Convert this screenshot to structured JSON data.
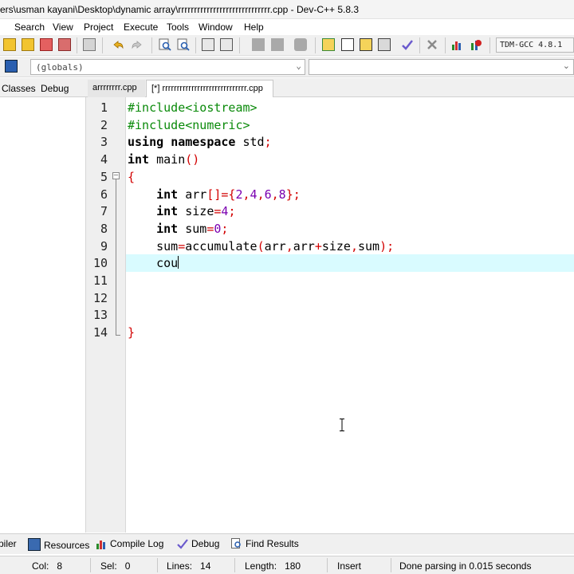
{
  "window": {
    "title": "ers\\usman kayani\\Desktop\\dynamic array\\rrrrrrrrrrrrrrrrrrrrrrrrrrrrr.cpp - Dev-C++ 5.8.3"
  },
  "menu": {
    "items": [
      "Search",
      "View",
      "Project",
      "Execute",
      "Tools",
      "Window",
      "Help"
    ]
  },
  "toolbar": {
    "compiler": "TDM-GCC 4.8.1"
  },
  "scope": {
    "value": "(globals)"
  },
  "left_tabs": [
    "Classes",
    "Debug"
  ],
  "file_tabs": [
    {
      "label": "arrrrrrrr.cpp",
      "active": false
    },
    {
      "label": "[*] rrrrrrrrrrrrrrrrrrrrrrrrrrrrr.cpp",
      "active": true
    }
  ],
  "editor": {
    "line_numbers": [
      "1",
      "2",
      "3",
      "4",
      "5",
      "6",
      "7",
      "8",
      "9",
      "10",
      "11",
      "12",
      "13",
      "14"
    ],
    "current_line": 10,
    "lines": [
      [
        {
          "t": "#include<iostream>",
          "c": "pp"
        }
      ],
      [
        {
          "t": "#include<numeric>",
          "c": "pp"
        }
      ],
      [
        {
          "t": "using",
          "c": "kw"
        },
        {
          "t": " ",
          "c": "id"
        },
        {
          "t": "namespace",
          "c": "kw"
        },
        {
          "t": " std",
          "c": "id"
        },
        {
          "t": ";",
          "c": "sym"
        }
      ],
      [
        {
          "t": "int",
          "c": "kw"
        },
        {
          "t": " main",
          "c": "id"
        },
        {
          "t": "()",
          "c": "sym"
        }
      ],
      [
        {
          "t": "{",
          "c": "sym"
        }
      ],
      [
        {
          "t": "    ",
          "c": "id"
        },
        {
          "t": "int",
          "c": "kw"
        },
        {
          "t": " arr",
          "c": "id"
        },
        {
          "t": "[]={",
          "c": "sym"
        },
        {
          "t": "2",
          "c": "num"
        },
        {
          "t": ",",
          "c": "sym"
        },
        {
          "t": "4",
          "c": "num"
        },
        {
          "t": ",",
          "c": "sym"
        },
        {
          "t": "6",
          "c": "num"
        },
        {
          "t": ",",
          "c": "sym"
        },
        {
          "t": "8",
          "c": "num"
        },
        {
          "t": "};",
          "c": "sym"
        }
      ],
      [
        {
          "t": "    ",
          "c": "id"
        },
        {
          "t": "int",
          "c": "kw"
        },
        {
          "t": " size",
          "c": "id"
        },
        {
          "t": "=",
          "c": "sym"
        },
        {
          "t": "4",
          "c": "num"
        },
        {
          "t": ";",
          "c": "sym"
        }
      ],
      [
        {
          "t": "    ",
          "c": "id"
        },
        {
          "t": "int",
          "c": "kw"
        },
        {
          "t": " sum",
          "c": "id"
        },
        {
          "t": "=",
          "c": "sym"
        },
        {
          "t": "0",
          "c": "num"
        },
        {
          "t": ";",
          "c": "sym"
        }
      ],
      [
        {
          "t": "    sum",
          "c": "id"
        },
        {
          "t": "=",
          "c": "sym"
        },
        {
          "t": "accumulate",
          "c": "id"
        },
        {
          "t": "(",
          "c": "sym"
        },
        {
          "t": "arr",
          "c": "id"
        },
        {
          "t": ",",
          "c": "sym"
        },
        {
          "t": "arr",
          "c": "id"
        },
        {
          "t": "+",
          "c": "sym"
        },
        {
          "t": "size",
          "c": "id"
        },
        {
          "t": ",",
          "c": "sym"
        },
        {
          "t": "sum",
          "c": "id"
        },
        {
          "t": ");",
          "c": "sym"
        }
      ],
      [
        {
          "t": "    cou",
          "c": "id"
        }
      ],
      [],
      [],
      [],
      [
        {
          "t": "}",
          "c": "sym"
        }
      ]
    ]
  },
  "bottom_tabs": [
    "piler",
    "Resources",
    "Compile Log",
    "Debug",
    "Find Results"
  ],
  "status": {
    "col_label": "Col:",
    "col_value": "8",
    "sel_label": "Sel:",
    "sel_value": "0",
    "lines_label": "Lines:",
    "lines_value": "14",
    "length_label": "Length:",
    "length_value": "180",
    "mode": "Insert",
    "message": "Done parsing in 0.015 seconds"
  }
}
